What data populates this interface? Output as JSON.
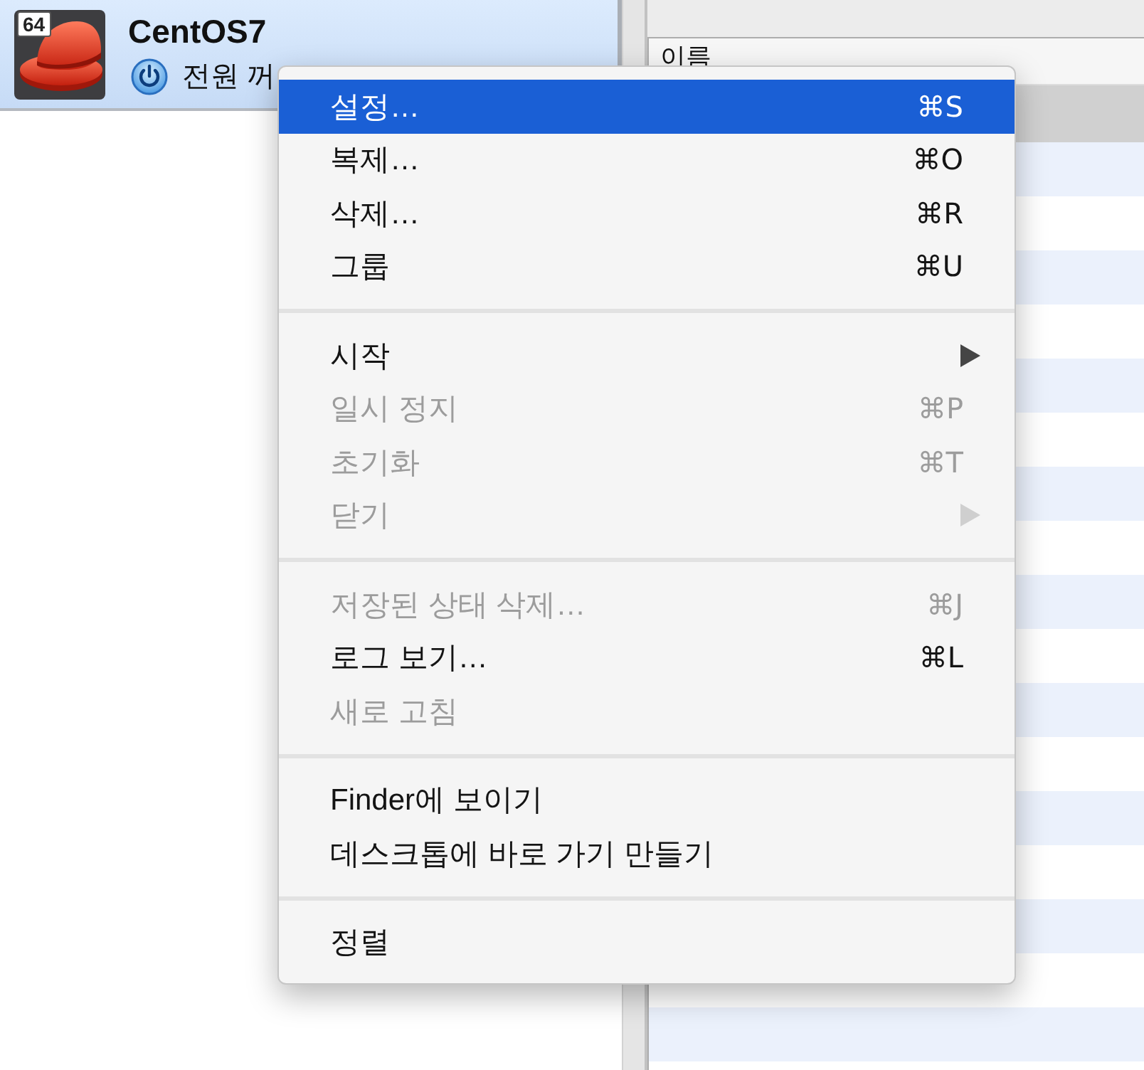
{
  "vm_list": {
    "items": [
      {
        "name": "CentOS7",
        "badge": "64",
        "status": "전원 꺼",
        "selected": true
      }
    ]
  },
  "details_table": {
    "columns": [
      "이름"
    ],
    "rows": [
      {
        "selected": true
      }
    ]
  },
  "context_menu": {
    "sections": [
      {
        "items": [
          {
            "label": "설정…",
            "shortcut": "⌘S",
            "selected": true,
            "disabled": false,
            "submenu": false
          },
          {
            "label": "복제…",
            "shortcut": "⌘O",
            "selected": false,
            "disabled": false,
            "submenu": false
          },
          {
            "label": "삭제…",
            "shortcut": "⌘R",
            "selected": false,
            "disabled": false,
            "submenu": false
          },
          {
            "label": "그룹",
            "shortcut": "⌘U",
            "selected": false,
            "disabled": false,
            "submenu": false
          }
        ]
      },
      {
        "items": [
          {
            "label": "시작",
            "selected": false,
            "disabled": false,
            "submenu": true
          },
          {
            "label": "일시 정지",
            "shortcut": "⌘P",
            "selected": false,
            "disabled": true,
            "submenu": false
          },
          {
            "label": "초기화",
            "shortcut": "⌘T",
            "selected": false,
            "disabled": true,
            "submenu": false
          },
          {
            "label": "닫기",
            "selected": false,
            "disabled": true,
            "submenu": true
          }
        ]
      },
      {
        "items": [
          {
            "label": "저장된 상태 삭제…",
            "shortcut": "⌘J",
            "selected": false,
            "disabled": true,
            "submenu": false
          },
          {
            "label": "로그 보기…",
            "shortcut": "⌘L",
            "selected": false,
            "disabled": false,
            "submenu": false
          },
          {
            "label": "새로 고침",
            "selected": false,
            "disabled": true,
            "submenu": false
          }
        ]
      },
      {
        "items": [
          {
            "label": "Finder에 보이기",
            "selected": false,
            "disabled": false,
            "submenu": false
          },
          {
            "label": "데스크톱에 바로 가기 만들기",
            "selected": false,
            "disabled": false,
            "submenu": false
          }
        ]
      },
      {
        "items": [
          {
            "label": "정렬",
            "selected": false,
            "disabled": false,
            "submenu": false
          }
        ]
      }
    ]
  }
}
